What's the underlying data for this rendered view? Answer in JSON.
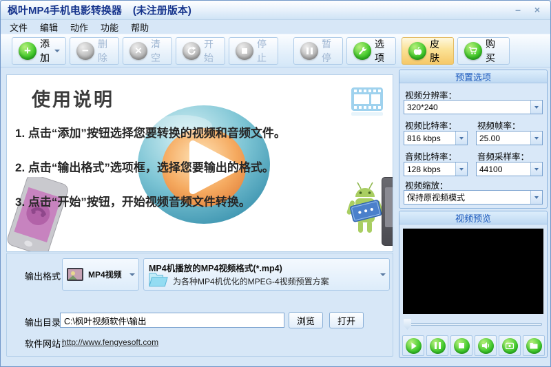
{
  "colors": {
    "accent_green": "#3fbf2f",
    "toolbar_highlight": "#f5c868",
    "title_text": "#16348c",
    "group_title_text": "#1a58bc",
    "play_sphere_outer": "#7cc4d4",
    "play_sphere_inner": "#f5aa60"
  },
  "window": {
    "title": "枫叶MP4手机电影转换器",
    "registration": "(未注册版本)",
    "controls": {
      "minimize": "–",
      "close": "×"
    }
  },
  "menubar": {
    "items": [
      {
        "label": "文件"
      },
      {
        "label": "编辑"
      },
      {
        "label": "动作"
      },
      {
        "label": "功能"
      },
      {
        "label": "帮助"
      }
    ]
  },
  "toolbar": {
    "buttons": [
      {
        "label": "添加",
        "state": "enabled",
        "has_dropdown": true
      },
      {
        "label": "删除",
        "state": "disabled"
      },
      {
        "label": "清空",
        "state": "disabled"
      },
      {
        "label": "开始",
        "state": "disabled"
      },
      {
        "label": "停止",
        "state": "disabled"
      },
      {
        "label": "暂停",
        "state": "disabled"
      },
      {
        "label": "选项",
        "state": "enabled"
      },
      {
        "label": "皮肤",
        "state": "highlighted"
      },
      {
        "label": "购买",
        "state": "enabled"
      }
    ]
  },
  "instructions": {
    "heading": "使用说明",
    "steps": [
      {
        "text": "1. 点击“添加”按钮选择您要转换的视频和音频文件。"
      },
      {
        "text": "2. 点击“输出格式”选项框，选择您要输出的格式。"
      },
      {
        "text": "3. 点击“开始”按钮，开始视频音频文件转换。"
      }
    ]
  },
  "preset_panel": {
    "title": "预置选项",
    "video_resolution": {
      "label": "视频分辨率：",
      "value": "320*240"
    },
    "video_bitrate": {
      "label": "视频比特率：",
      "value": "816 kbps"
    },
    "video_framerate": {
      "label": "视频帧率：",
      "value": "25.00"
    },
    "audio_bitrate": {
      "label": "音频比特率：",
      "value": "128 kbps"
    },
    "audio_samplerate": {
      "label": "音频采样率：",
      "value": "44100"
    },
    "video_scale": {
      "label": "视频缩放：",
      "value": "保持原视频模式"
    }
  },
  "preview_panel": {
    "title": "视频预览"
  },
  "output": {
    "format_label": "输出格式：",
    "format_type": "MP4视频",
    "format_name": "MP4机播放的MP4视频格式(*.mp4)",
    "format_desc": "为各种MP4机优化的MPEG-4视频预置方案",
    "dir_label": "输出目录：",
    "dir_value": "C:\\枫叶视频软件\\输出",
    "browse_label": "浏览",
    "open_label": "打开",
    "site_label": "软件网站：",
    "site_url": "http://www.fengyesoft.com"
  }
}
